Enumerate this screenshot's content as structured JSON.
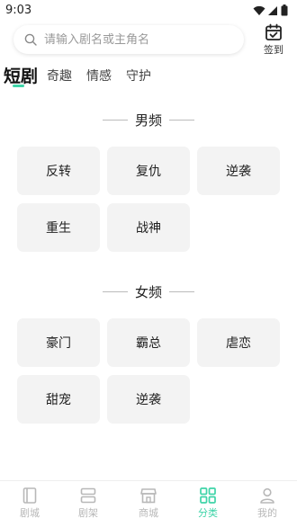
{
  "status_bar": {
    "time": "9:03"
  },
  "search": {
    "placeholder": "请输入剧名或主角名"
  },
  "checkin": {
    "label": "签到"
  },
  "tabs": [
    {
      "label": "短剧",
      "active": true
    },
    {
      "label": "奇趣",
      "active": false
    },
    {
      "label": "情感",
      "active": false
    },
    {
      "label": "守护",
      "active": false
    }
  ],
  "sections": [
    {
      "title": "男频",
      "items": [
        "反转",
        "复仇",
        "逆袭",
        "重生",
        "战神"
      ]
    },
    {
      "title": "女频",
      "items": [
        "豪门",
        "霸总",
        "虐恋",
        "甜宠",
        "逆袭"
      ]
    }
  ],
  "bottom_nav": [
    {
      "label": "剧城",
      "icon": "book-icon",
      "active": false
    },
    {
      "label": "剧架",
      "icon": "shelf-icon",
      "active": false
    },
    {
      "label": "商城",
      "icon": "store-icon",
      "active": false
    },
    {
      "label": "分类",
      "icon": "category-icon",
      "active": true
    },
    {
      "label": "我的",
      "icon": "profile-icon",
      "active": false
    }
  ],
  "colors": {
    "accent": "#3fd4a8",
    "chip_bg": "#f3f3f3",
    "nav_inactive": "#b8b8b8"
  }
}
